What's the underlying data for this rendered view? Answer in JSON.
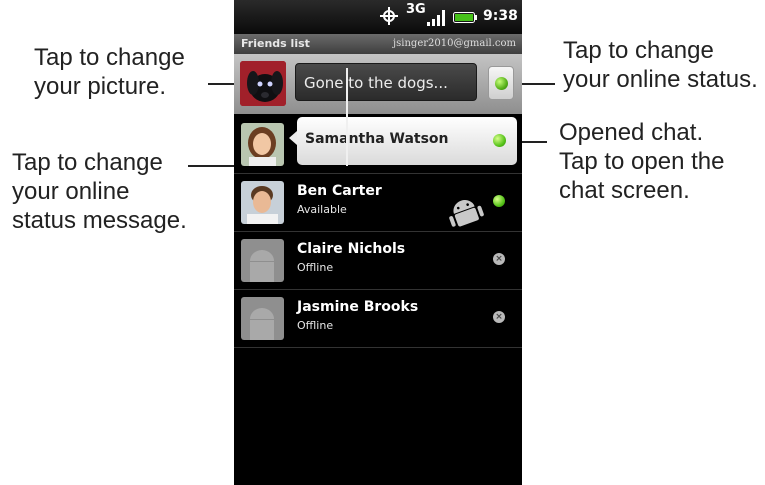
{
  "callouts": {
    "picture": [
      "Tap to change",
      "your picture."
    ],
    "status_message": [
      "Tap to change",
      "your online",
      "status message."
    ],
    "online_status": [
      "Tap to change",
      "your online status."
    ],
    "opened_chat": [
      "Opened chat.",
      "Tap to open the",
      "chat screen."
    ]
  },
  "status_bar": {
    "network": "3G",
    "time": "9:38 PM"
  },
  "header": {
    "title": "Friends list",
    "account": "jsinger2010@gmail.com"
  },
  "me": {
    "status_message": "Gone to the dogs...",
    "status_color": "#56b019"
  },
  "friends": [
    {
      "name": "Samantha  Watson",
      "status": "",
      "presence": "online",
      "opened_chat": true
    },
    {
      "name": "Ben Carter",
      "status": "Available",
      "presence": "online"
    },
    {
      "name": "Claire Nichols",
      "status": "Offline",
      "presence": "offline"
    },
    {
      "name": "Jasmine Brooks",
      "status": "Offline",
      "presence": "offline"
    }
  ],
  "icons": {
    "gps": "gps-crosshair-icon",
    "signal": "signal-bars-icon",
    "battery": "battery-icon",
    "online": "online-green-dot-icon",
    "offline": "offline-x-icon",
    "android": "android-robot-icon"
  }
}
